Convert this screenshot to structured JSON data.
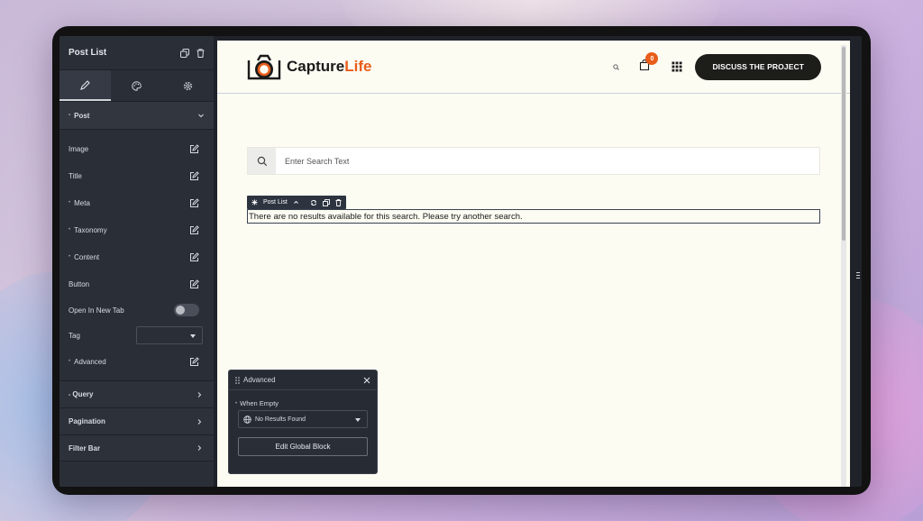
{
  "sidebar": {
    "title": "Post List",
    "sections": {
      "post": "Post",
      "query": "Query",
      "pagination": "Pagination",
      "filter_bar": "Filter Bar"
    },
    "items": [
      {
        "label": "Image"
      },
      {
        "label": "Title"
      },
      {
        "label": "Meta"
      },
      {
        "label": "Taxonomy"
      },
      {
        "label": "Content"
      },
      {
        "label": "Button"
      }
    ],
    "open_new_tab": "Open In New Tab",
    "tag": "Tag",
    "advanced": "Advanced"
  },
  "site": {
    "logo_main": "Capture",
    "logo_accent": "Life",
    "cart_count": "0",
    "cta": "DISCUSS THE PROJECT"
  },
  "search": {
    "placeholder": "Enter Search Text"
  },
  "post_list": {
    "toolbar_label": "Post List",
    "empty_message": "There are no results available for this search. Please try another search."
  },
  "popover": {
    "title": "Advanced",
    "when_empty": "When Empty",
    "select_value": "No Results Found",
    "button": "Edit Global Block"
  },
  "colors": {
    "accent": "#e85d1a",
    "sidebar_bg": "#2a2e37",
    "canvas_bg": "#fdfcf3",
    "cta_bg": "#1d1d1a"
  }
}
